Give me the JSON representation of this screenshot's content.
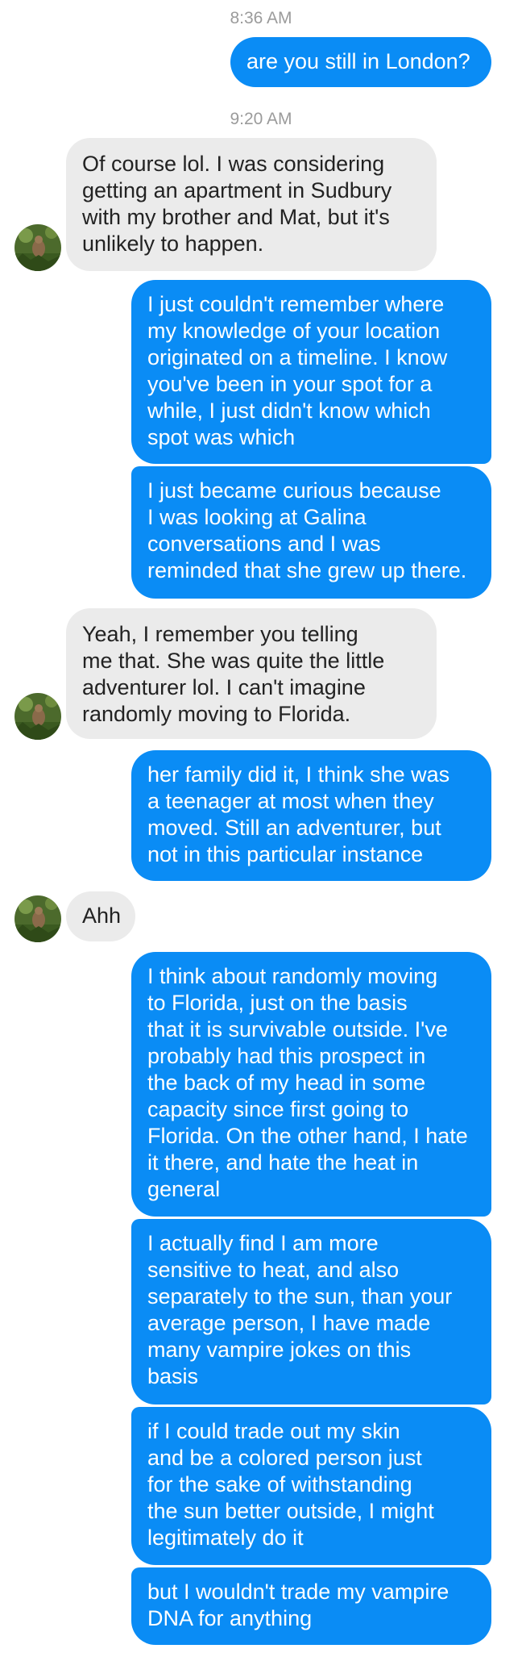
{
  "conversation": {
    "timestamps": [
      "8:36 AM",
      "9:20 AM"
    ],
    "messages": [
      {
        "from": "me",
        "text": "are you still in London?"
      },
      {
        "from": "them",
        "text": "Of course lol. I was considering\ngetting an apartment in Sudbury\nwith my brother and Mat, but it's\nunlikely to happen."
      },
      {
        "from": "me",
        "text": "I just couldn't remember where\nmy knowledge of your location\noriginated on a timeline. I know\nyou've been in your spot for a\nwhile, I just didn't know which\nspot was which"
      },
      {
        "from": "me",
        "text": "I just became curious because\nI was looking at Galina\nconversations and I was\nreminded that she grew up there."
      },
      {
        "from": "them",
        "text": "Yeah, I remember you telling\nme that. She was quite the little\nadventurer lol. I can't imagine\nrandomly moving to Florida."
      },
      {
        "from": "me",
        "text": "her family did it, I think she was\na teenager at most when they\nmoved. Still an adventurer, but\nnot in this particular instance"
      },
      {
        "from": "them",
        "text": "Ahh"
      },
      {
        "from": "me",
        "text": "I think about randomly moving\nto Florida, just on the basis\nthat it is survivable outside. I've\nprobably had this prospect in\nthe back of my head in some\ncapacity since first going to\nFlorida. On the other hand, I hate\nit there, and hate the heat in\ngeneral"
      },
      {
        "from": "me",
        "text": "I actually find I am more\nsensitive to heat, and also\nseparately to the sun, than your\naverage person, I have made\nmany vampire jokes on this\nbasis"
      },
      {
        "from": "me",
        "text": "if I could trade out my skin\nand be a colored person just\nfor the sake of withstanding\nthe sun better outside, I might\nlegitimately do it"
      },
      {
        "from": "me",
        "text": "but I wouldn't trade my vampire\nDNA for anything"
      }
    ]
  },
  "colors": {
    "sent_bubble": "#0a8cf5",
    "received_bubble": "#ebebeb",
    "timestamp_text": "#9b9b9b"
  },
  "icons": {
    "avatar": "contact-avatar-photo"
  }
}
